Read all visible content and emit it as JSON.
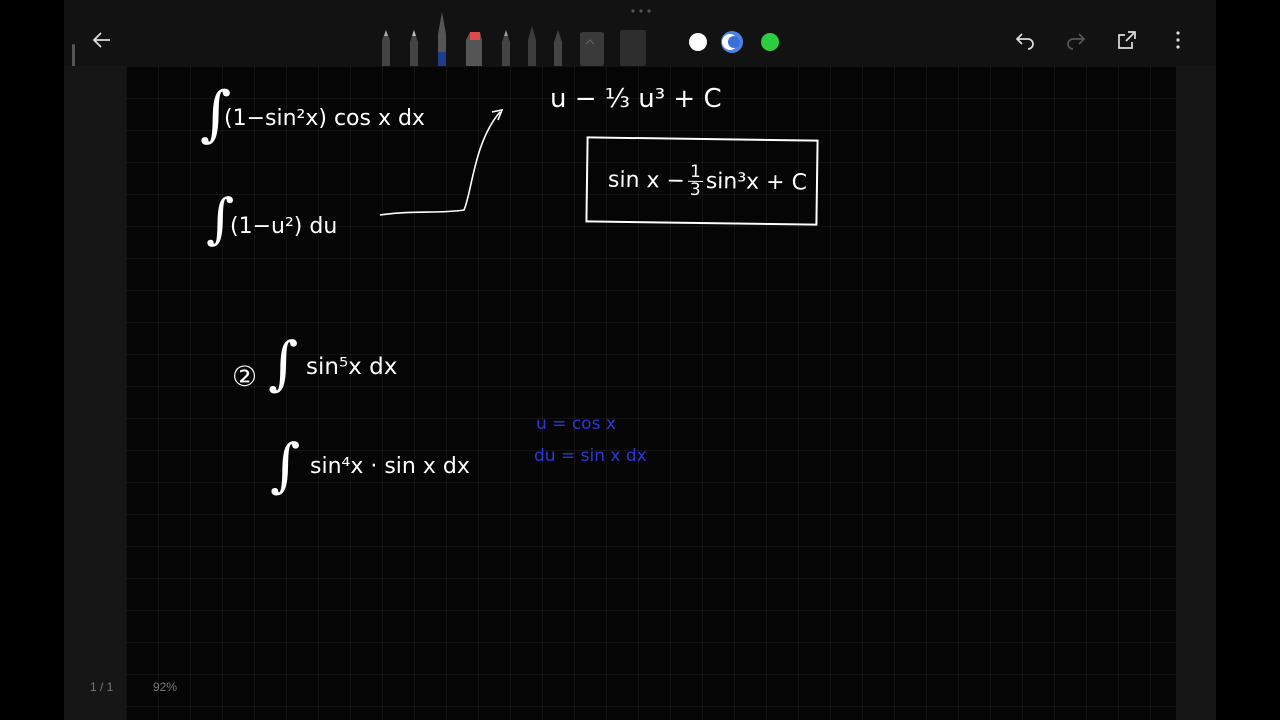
{
  "toolbar": {
    "back_icon": "arrow-left-icon",
    "tools": [
      "pencil",
      "pencil",
      "fountain-pen",
      "highlighter",
      "pencil",
      "ballpoint-pen",
      "pencil",
      "eraser",
      "marker"
    ],
    "colors": [
      "#ffffff",
      "#3a6fd8",
      "#2ecc40"
    ],
    "actions": [
      "undo-icon",
      "redo-icon",
      "share-icon",
      "more-icon"
    ]
  },
  "notes": {
    "line1": "(1−sin²x) cos x dx",
    "line2": "(1−u²) du",
    "result1": "u − ⅓ u³ + C",
    "boxed_answer_part1": "sin x − ",
    "boxed_num": "1",
    "boxed_den": "3",
    "boxed_answer_part2": " sin³x + C",
    "problem_number": "②",
    "line3": "sin⁵x dx",
    "line4": "sin⁴x · sin x dx",
    "sub1": "u = cos x",
    "sub2": "du = sin x dx"
  },
  "status": {
    "page": "1 / 1",
    "zoom": "92%"
  }
}
